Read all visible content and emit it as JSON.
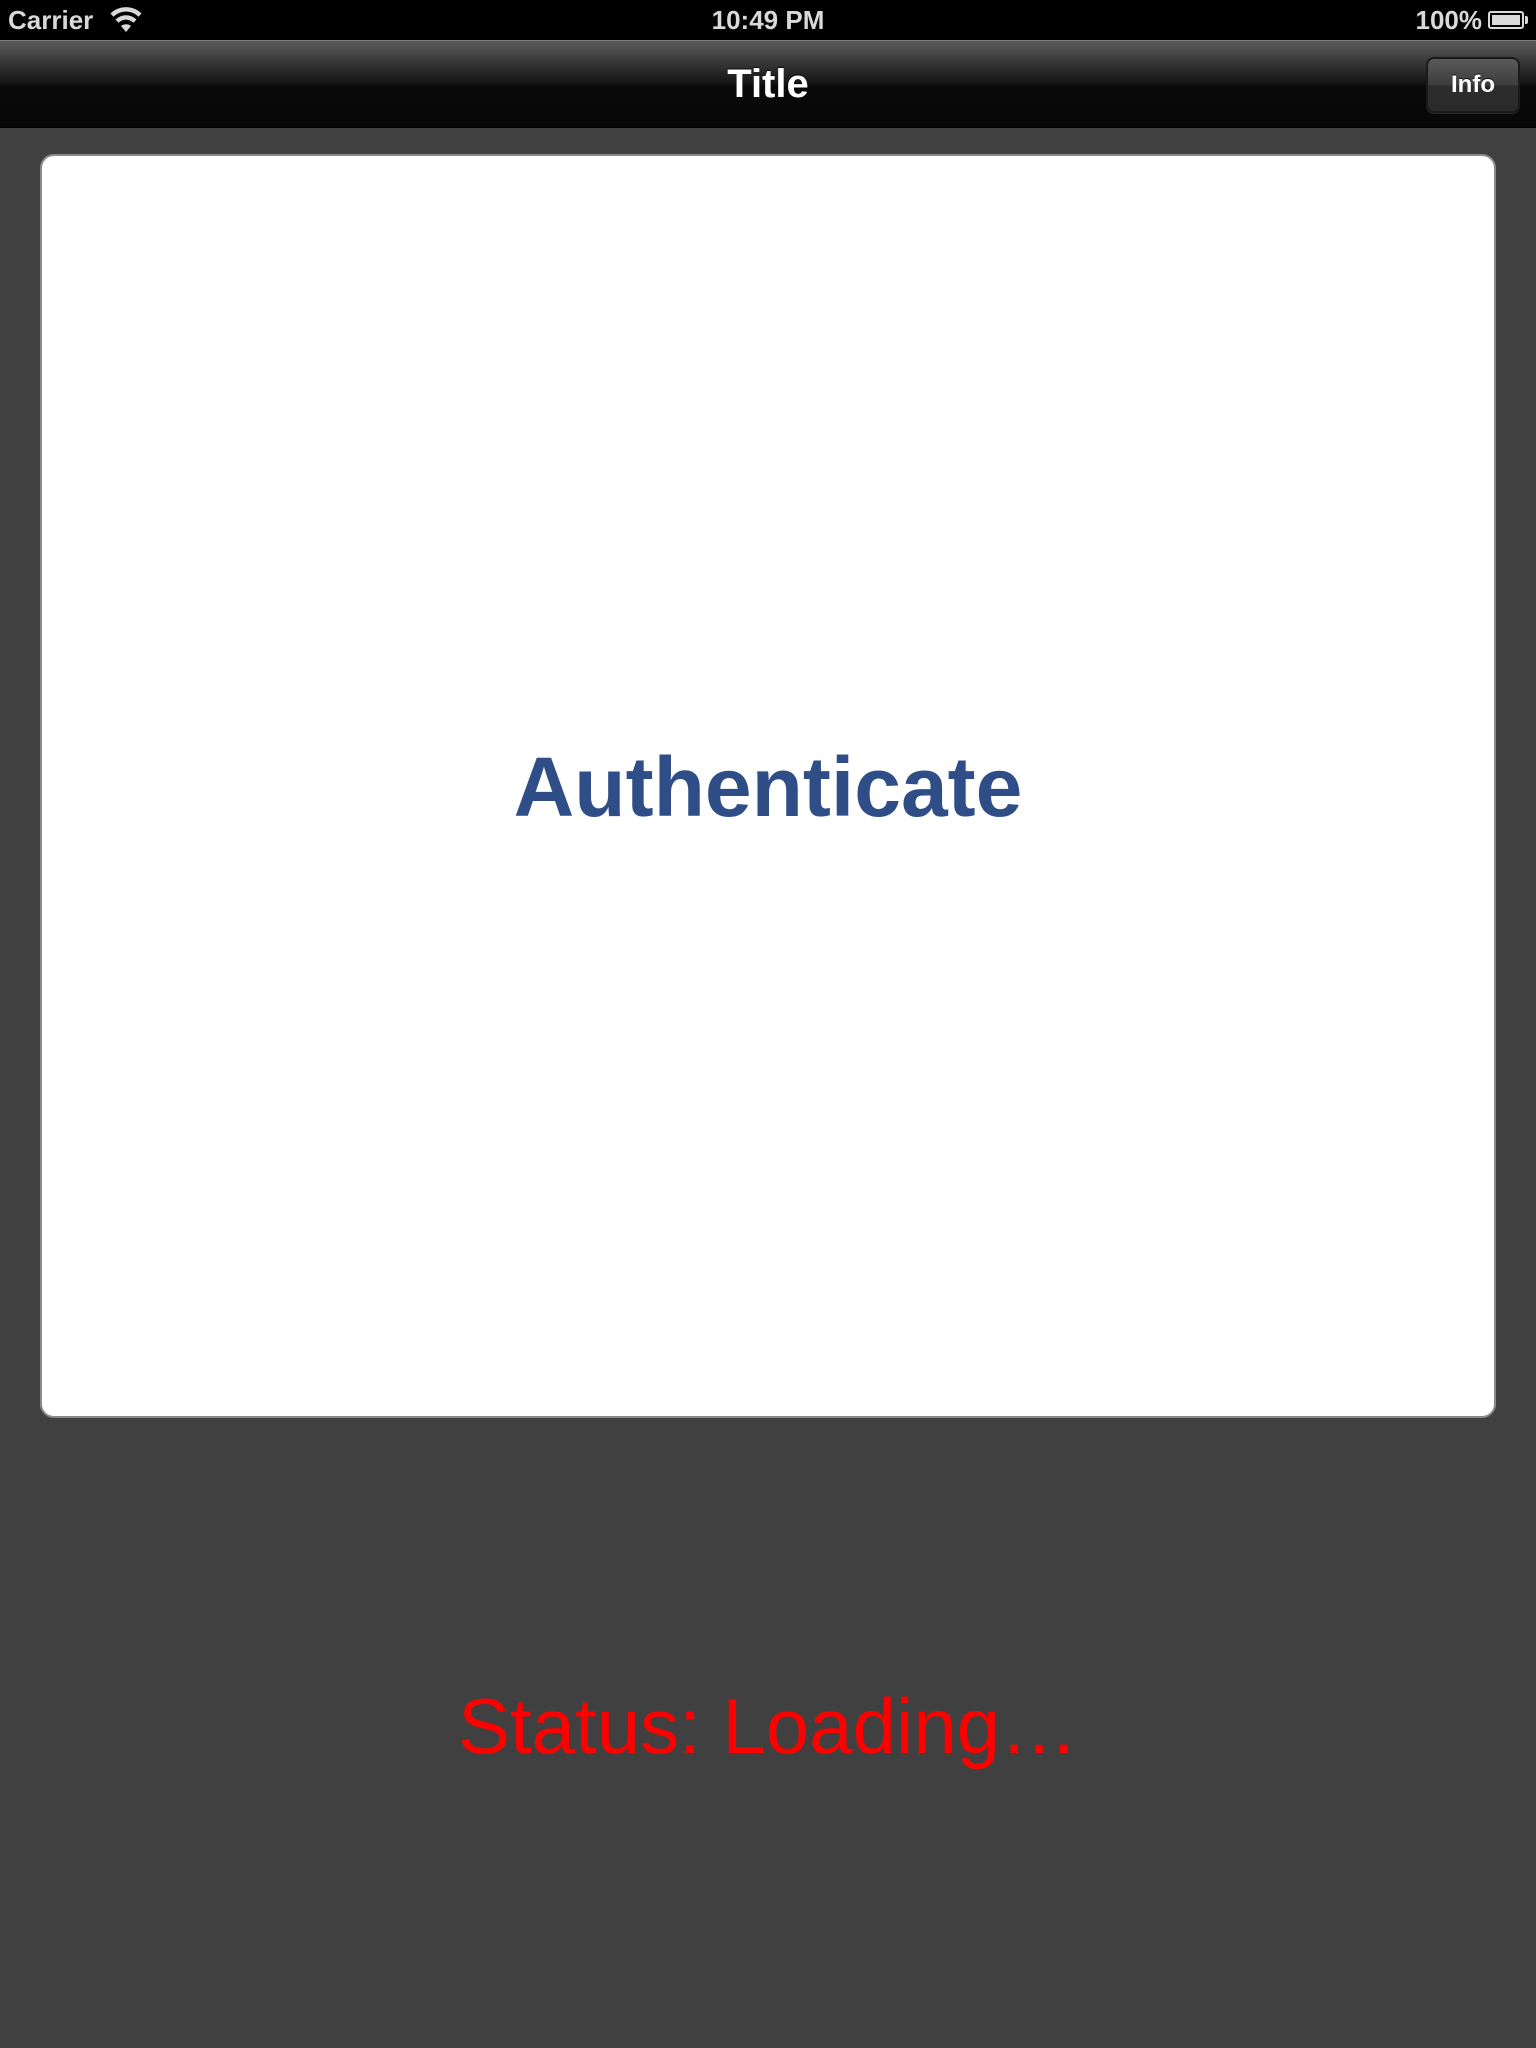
{
  "status_bar": {
    "carrier": "Carrier",
    "time": "10:49 PM",
    "battery_percent": "100%",
    "battery_level": 1.0,
    "wifi_icon": "wifi-icon",
    "battery_icon": "battery-icon"
  },
  "nav_bar": {
    "title": "Title",
    "info_button_label": "Info"
  },
  "main": {
    "authenticate_label": "Authenticate",
    "status_text": "Status: Loading…"
  },
  "colors": {
    "background": "#404040",
    "authenticate_text": "#2f4e88",
    "status_text": "#ff0000"
  }
}
